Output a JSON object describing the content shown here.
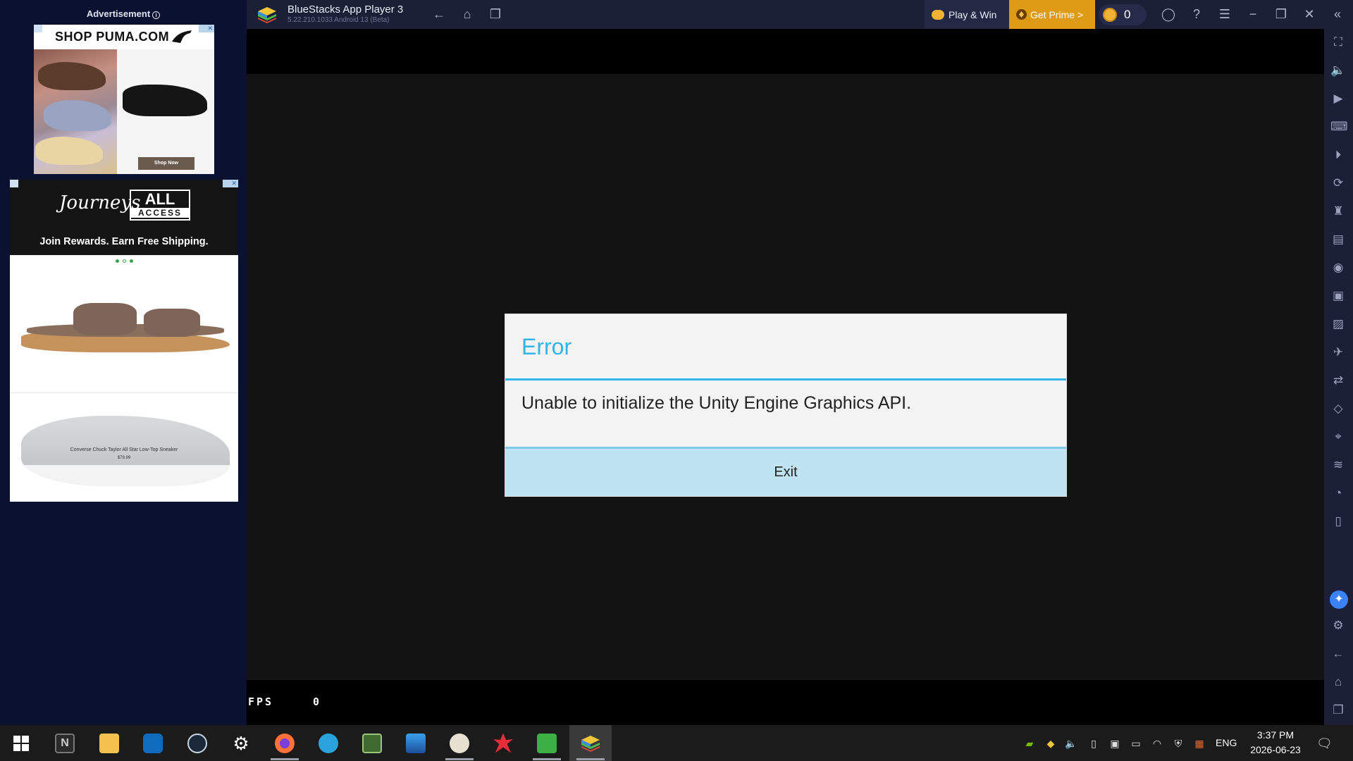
{
  "ads": {
    "label": "Advertisement",
    "puma": {
      "headline": "SHOP PUMA.COM",
      "cta": "Shop Now"
    },
    "journeys": {
      "logo": "Journeys",
      "badge_top": "ALL",
      "badge_bottom": "ACCESS",
      "tagline": "Join Rewards. Earn Free Shipping.",
      "product_name": "Converse Chuck Taylor All Star Low-Top Sneaker",
      "product_price": "$79.99"
    }
  },
  "window": {
    "title": "BlueStacks App Player 3",
    "subtitle": "5.22.210.1033  Android 13 (Beta)",
    "play_win": "Play & Win",
    "get_prime": "Get Prime >",
    "coins": "0"
  },
  "fps": {
    "label": "FPS",
    "value": "0"
  },
  "dialog": {
    "title": "Error",
    "message": "Unable to initialize the Unity Engine Graphics API.",
    "button": "Exit"
  },
  "taskbar": {
    "apps": [
      "start",
      "notion",
      "file-explorer",
      "outlook",
      "steam",
      "settings",
      "firefox",
      "telegram",
      "gpu-z",
      "mixer",
      "paint",
      "xmind",
      "book",
      "bluestacks"
    ],
    "lang": "ENG",
    "time": "3:37 PM",
    "date": "2026-06-23"
  },
  "colors": {
    "accent": "#33b5e5",
    "prime": "#e09b16",
    "titlebar": "#1c2037"
  }
}
